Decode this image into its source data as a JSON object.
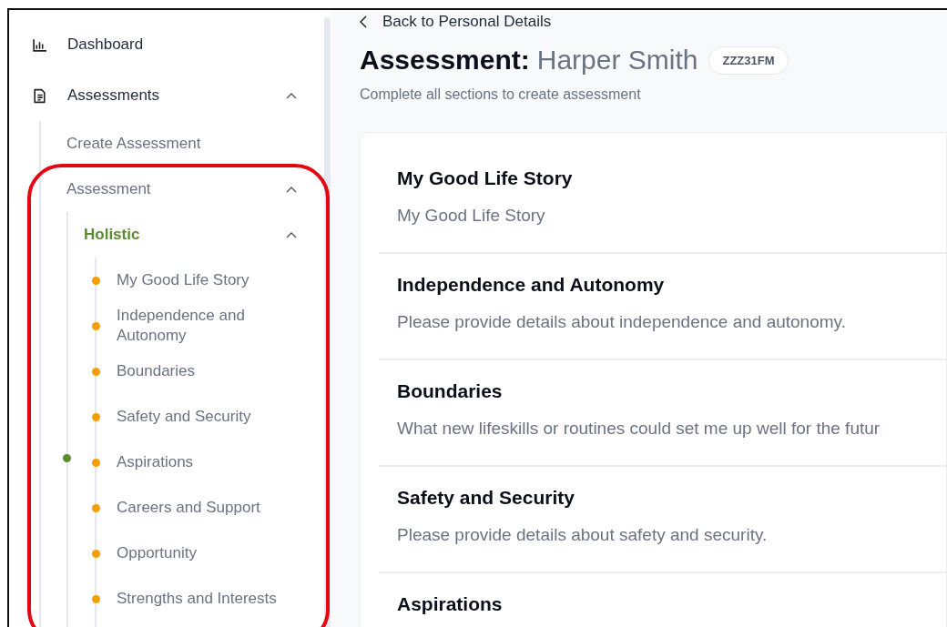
{
  "sidebar": {
    "items": [
      {
        "label": "Dashboard",
        "kind": "chart"
      },
      {
        "label": "Assessments",
        "kind": "document",
        "expanded": true,
        "children": [
          {
            "label": "Create Assessment"
          },
          {
            "label": "Assessment",
            "expanded": true,
            "children": [
              {
                "label": "Holistic",
                "expanded": true,
                "selected": true,
                "children": [
                  {
                    "label": "My Good Life Story",
                    "color": "#f59e0b",
                    "current": false
                  },
                  {
                    "label": "Independence and Autonomy",
                    "color": "#f59e0b",
                    "current": false
                  },
                  {
                    "label": "Boundaries",
                    "color": "#f59e0b",
                    "current": false
                  },
                  {
                    "label": "Safety and Security",
                    "color": "#f59e0b",
                    "current": false
                  },
                  {
                    "label": "Aspirations",
                    "color": "#f59e0b",
                    "current": true
                  },
                  {
                    "label": "Careers and Support",
                    "color": "#f59e0b",
                    "current": false
                  },
                  {
                    "label": "Opportunity",
                    "color": "#f59e0b",
                    "current": false
                  },
                  {
                    "label": "Strengths and Interests",
                    "color": "#f59e0b",
                    "current": false
                  }
                ]
              }
            ]
          }
        ]
      }
    ]
  },
  "header": {
    "back_link": "Back to Personal Details",
    "title_label": "Assessment:",
    "person_name": "Harper Smith",
    "id_badge": "ZZZ31FM",
    "subtitle": "Complete all sections to create assessment"
  },
  "sections": [
    {
      "heading": "My Good Life Story",
      "description": "My Good Life Story"
    },
    {
      "heading": "Independence and Autonomy",
      "description": "Please provide details about independence and autonomy."
    },
    {
      "heading": "Boundaries",
      "description": "What new lifeskills or routines could set me up well for the futur"
    },
    {
      "heading": "Safety and Security",
      "description": "Please provide details about safety and security."
    },
    {
      "heading": "Aspirations"
    }
  ],
  "annotations": [
    {
      "kind": "outline"
    }
  ]
}
